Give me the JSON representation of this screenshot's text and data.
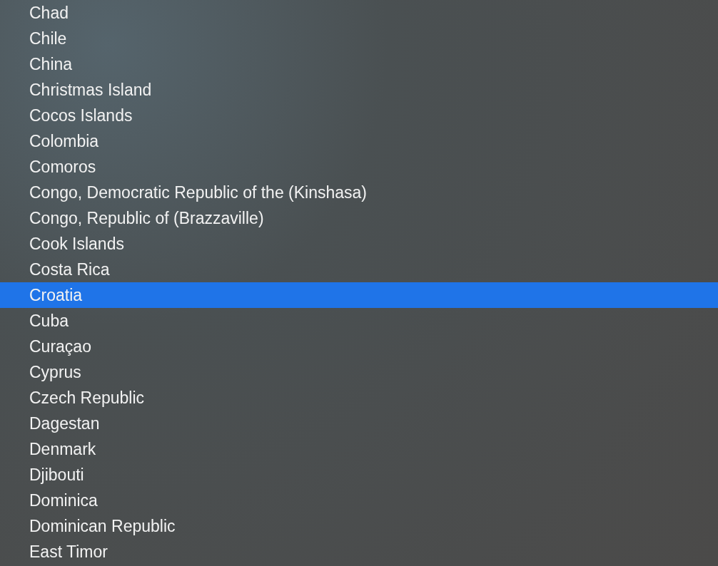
{
  "countries": [
    {
      "label": "Chad",
      "selected": false
    },
    {
      "label": "Chile",
      "selected": false
    },
    {
      "label": "China",
      "selected": false
    },
    {
      "label": "Christmas Island",
      "selected": false
    },
    {
      "label": "Cocos Islands",
      "selected": false
    },
    {
      "label": "Colombia",
      "selected": false
    },
    {
      "label": "Comoros",
      "selected": false
    },
    {
      "label": "Congo, Democratic Republic of the (Kinshasa)",
      "selected": false
    },
    {
      "label": "Congo, Republic of (Brazzaville)",
      "selected": false
    },
    {
      "label": "Cook Islands",
      "selected": false
    },
    {
      "label": "Costa Rica",
      "selected": false
    },
    {
      "label": "Croatia",
      "selected": true
    },
    {
      "label": "Cuba",
      "selected": false
    },
    {
      "label": "Curaçao",
      "selected": false
    },
    {
      "label": "Cyprus",
      "selected": false
    },
    {
      "label": "Czech Republic",
      "selected": false
    },
    {
      "label": "Dagestan",
      "selected": false
    },
    {
      "label": "Denmark",
      "selected": false
    },
    {
      "label": "Djibouti",
      "selected": false
    },
    {
      "label": "Dominica",
      "selected": false
    },
    {
      "label": "Dominican Republic",
      "selected": false
    },
    {
      "label": "East Timor",
      "selected": false
    }
  ]
}
